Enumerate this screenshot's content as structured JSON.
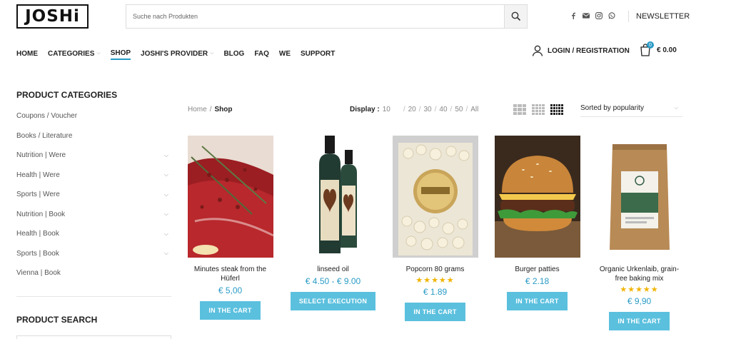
{
  "brand": {
    "logo": "JOSHi"
  },
  "search": {
    "placeholder": "Suche nach Produkten"
  },
  "header": {
    "social": [
      "facebook-icon",
      "mail-icon",
      "instagram-icon",
      "whatsapp-icon"
    ],
    "newsletter": "NEWSLETTER"
  },
  "nav": {
    "items": [
      {
        "label": "HOME",
        "dropdown": false
      },
      {
        "label": "CATEGORIES",
        "dropdown": true
      },
      {
        "label": "SHOP",
        "dropdown": false,
        "active": true
      },
      {
        "label": "JOSHI'S PROVIDER",
        "dropdown": true
      },
      {
        "label": "BLOG",
        "dropdown": false
      },
      {
        "label": "FAQ",
        "dropdown": false
      },
      {
        "label": "WE",
        "dropdown": false
      },
      {
        "label": "SUPPORT",
        "dropdown": false
      }
    ],
    "login": "LOGIN / REGISTRATION",
    "cart_count": "0",
    "cart_total": "€ 0.00"
  },
  "sidebar": {
    "categories_title": "PRODUCT CATEGORIES",
    "categories": [
      {
        "label": "Coupons / Voucher",
        "expandable": false
      },
      {
        "label": "Books / Literature",
        "expandable": false
      },
      {
        "label": "Nutrition | Were",
        "expandable": true
      },
      {
        "label": "Health | Were",
        "expandable": true
      },
      {
        "label": "Sports | Were",
        "expandable": true
      },
      {
        "label": "Nutrition | Book",
        "expandable": true
      },
      {
        "label": "Health | Book",
        "expandable": true
      },
      {
        "label": "Sports | Book",
        "expandable": true
      },
      {
        "label": "Vienna | Book",
        "expandable": false
      }
    ],
    "search_title": "PRODUCT SEARCH"
  },
  "toolbar": {
    "breadcrumb_home": "Home",
    "breadcrumb_sep": "/",
    "breadcrumb_current": "Shop",
    "display_label": "Display :",
    "display_options": [
      "10",
      "20",
      "30",
      "40",
      "50",
      "All"
    ],
    "sort_label": "Sorted by popularity"
  },
  "products": [
    {
      "name": "Minutes steak from the Hüferl",
      "price": "€ 5,00",
      "stars": 0,
      "button": "IN THE CART"
    },
    {
      "name": "linseed oil",
      "price": "€ 4.50 - € 9.00",
      "stars": 0,
      "button": "SELECT EXECUTION"
    },
    {
      "name": "Popcorn 80 grams",
      "price": "€ 1.89",
      "stars": 5,
      "button": "IN THE CART"
    },
    {
      "name": "Burger patties",
      "price": "€ 2.18",
      "stars": 0,
      "button": "IN THE CART"
    },
    {
      "name": "Organic Urkenlaib, grain-free baking mix",
      "price": "€ 9,90",
      "stars": 5,
      "button": "IN THE CART"
    }
  ],
  "colors": {
    "accent": "#2a9bc6",
    "button": "#5bc0de",
    "stars": "#f1b400"
  }
}
